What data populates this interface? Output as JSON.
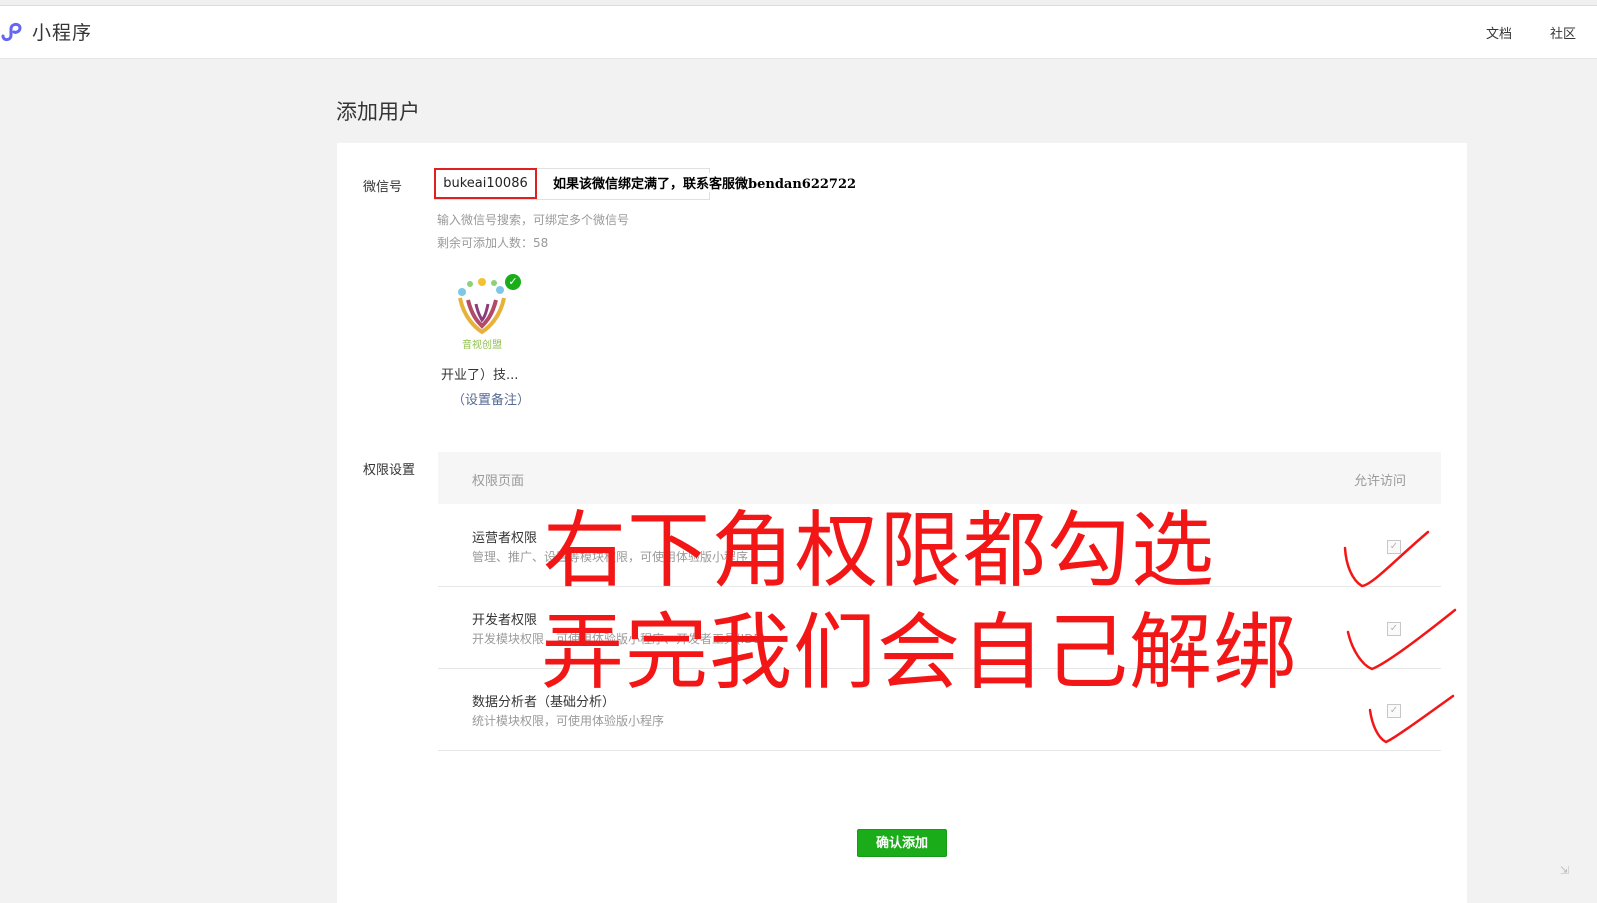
{
  "header": {
    "brand": "小程序",
    "nav": [
      "文档",
      "社区"
    ]
  },
  "page_title": "添加用户",
  "form": {
    "wechat_label": "微信号",
    "wechat_value": "bukeai10086",
    "annotation_note": "如果该微信绑定满了，联系客服微bendan622722",
    "search_tip": "输入微信号搜索，可绑定多个微信号",
    "remaining_label": "剩余可添加人数：58",
    "user": {
      "avatar_caption": "音视创盟",
      "name": "开业了）技...",
      "remark_link": "（设置备注）"
    }
  },
  "permissions": {
    "label": "权限设置",
    "header_page": "权限页面",
    "header_allow": "允许访问",
    "rows": [
      {
        "title": "运营者权限",
        "desc": "管理、推广、设置等模块权限，可使用体验版小程序",
        "checked": true
      },
      {
        "title": "开发者权限",
        "desc": "开发模块权限，可使用体验版小程序、开发者工具(IDE)",
        "checked": true
      },
      {
        "title": "数据分析者（基础分析）",
        "desc": "统计模块权限，可使用体验版小程序",
        "checked": true
      }
    ]
  },
  "confirm_button": "确认添加",
  "overlay": {
    "line1": "右下角权限都勾选",
    "line2": "弄完我们会自己解绑",
    "color": "#f31616"
  },
  "colors": {
    "accent_green": "#1aad19",
    "link_blue": "#576b95",
    "highlight_red": "#e02020"
  }
}
